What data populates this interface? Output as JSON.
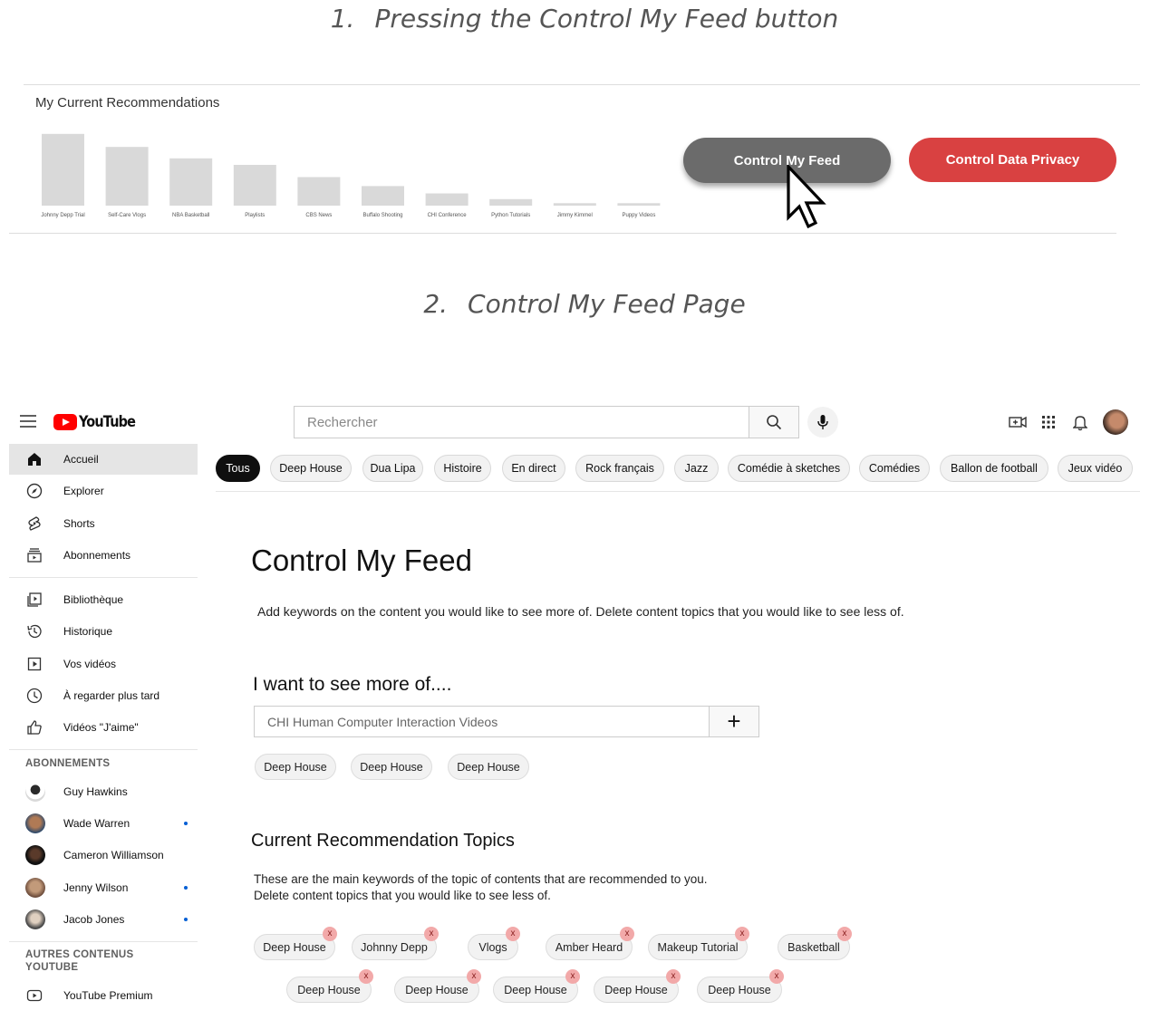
{
  "steps": {
    "step1": {
      "num": "1.",
      "title": "Pressing the Control My Feed button"
    },
    "step2": {
      "num": "2.",
      "title": "Control My Feed Page"
    }
  },
  "recommendations": {
    "title": "My Current Recommendations",
    "bars": [
      {
        "label": "Johnny Depp Trial",
        "value": 88
      },
      {
        "label": "Self-Care Vlogs",
        "value": 72
      },
      {
        "label": "NBA Basketball",
        "value": 58
      },
      {
        "label": "Playlists",
        "value": 50
      },
      {
        "label": "CBS News",
        "value": 35
      },
      {
        "label": "Buffalo Shooting",
        "value": 24
      },
      {
        "label": "CHI Conference",
        "value": 15
      },
      {
        "label": "Python Tutorials",
        "value": 8
      },
      {
        "label": "Jimmy Kimmel",
        "value": 3
      },
      {
        "label": "Puppy Videos",
        "value": 3
      }
    ],
    "control_button": "Control My Feed",
    "privacy_button": "Control Data Privacy"
  },
  "colors": {
    "brand_red": "#ff0000",
    "privacy_red": "#d94141",
    "control_gray": "#6b6b6b"
  },
  "header": {
    "logo_text": "YouTube",
    "search_placeholder": "Rechercher"
  },
  "sidebar": {
    "main": [
      {
        "label": "Accueil",
        "icon": "home-icon"
      },
      {
        "label": "Explorer",
        "icon": "compass-icon"
      },
      {
        "label": "Shorts",
        "icon": "shorts-icon"
      },
      {
        "label": "Abonnements",
        "icon": "subscriptions-icon"
      }
    ],
    "library": [
      {
        "label": "Bibliothèque",
        "icon": "library-icon"
      },
      {
        "label": "Historique",
        "icon": "history-icon"
      },
      {
        "label": "Vos vidéos",
        "icon": "your-videos-icon"
      },
      {
        "label": "À regarder plus tard",
        "icon": "watch-later-icon"
      },
      {
        "label": "Vidéos \"J'aime\"",
        "icon": "thumbs-up-icon"
      }
    ],
    "subscriptions_heading": "ABONNEMENTS",
    "subscriptions": [
      {
        "label": "Guy Hawkins"
      },
      {
        "label": "Wade Warren"
      },
      {
        "label": "Cameron Williamson"
      },
      {
        "label": "Jenny Wilson"
      },
      {
        "label": "Jacob Jones"
      }
    ],
    "other_heading_1": "AUTRES CONTENUS",
    "other_heading_2": "YOUTUBE",
    "other": [
      {
        "label": "YouTube Premium",
        "icon": "youtube-premium-icon"
      }
    ]
  },
  "chips": [
    "Tous",
    "Deep House",
    "Dua Lipa",
    "Histoire",
    "En direct",
    "Rock français",
    "Jazz",
    "Comédie à sketches",
    "Comédies",
    "Ballon de football",
    "Jeux vidéo"
  ],
  "feed": {
    "title": "Control My Feed",
    "description": "Add keywords on the content you would like to see more of. Delete content topics that you would like to see less of.",
    "more_title": "I want to see more of....",
    "input_value": "CHI Human Computer Interaction Videos",
    "add_label": "+",
    "added_keywords": [
      "Deep House",
      "Deep House",
      "Deep House"
    ],
    "current_title": "Current Recommendation Topics",
    "current_desc_1": "These are the main keywords of the topic of contents that are recommended to you.",
    "current_desc_2": "Delete content topics that you would like to see less of.",
    "topics_row1": [
      "Deep House",
      "Johnny Depp",
      "Vlogs",
      "Amber Heard",
      "Makeup Tutorial",
      "Basketball"
    ],
    "topics_row2": [
      "Deep House",
      "Deep House",
      "Deep House",
      "Deep House",
      "Deep House"
    ],
    "remove_label": "x"
  }
}
